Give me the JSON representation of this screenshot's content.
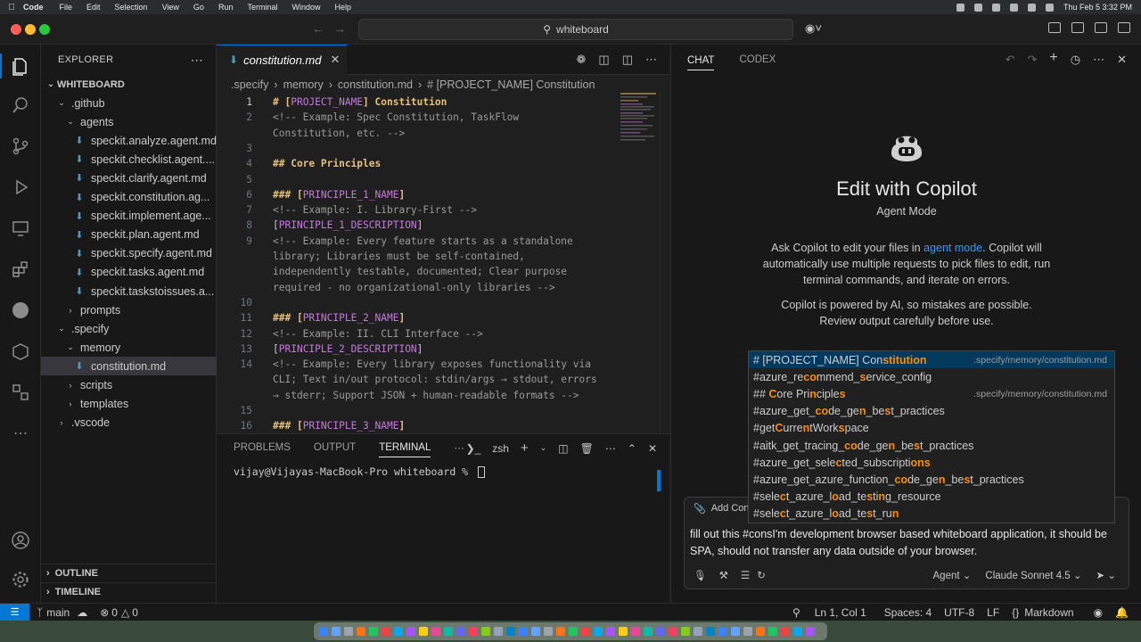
{
  "macbar": {
    "app": "Code",
    "menus": [
      "File",
      "Edit",
      "Selection",
      "View",
      "Go",
      "Run",
      "Terminal",
      "Window",
      "Help"
    ],
    "clock": "Thu Feb 5  3:32 PM"
  },
  "titlebar": {
    "search": "whiteboard"
  },
  "explorer": {
    "title": "EXPLORER",
    "root": "WHITEBOARD",
    "rows": [
      {
        "label": ".github",
        "kind": "folder-open",
        "indent": 1
      },
      {
        "label": "agents",
        "kind": "folder-open",
        "indent": 2
      },
      {
        "label": "speckit.analyze.agent.md",
        "kind": "file",
        "indent": 3
      },
      {
        "label": "speckit.checklist.agent....",
        "kind": "file",
        "indent": 3
      },
      {
        "label": "speckit.clarify.agent.md",
        "kind": "file",
        "indent": 3
      },
      {
        "label": "speckit.constitution.ag...",
        "kind": "file",
        "indent": 3
      },
      {
        "label": "speckit.implement.age...",
        "kind": "file",
        "indent": 3
      },
      {
        "label": "speckit.plan.agent.md",
        "kind": "file",
        "indent": 3
      },
      {
        "label": "speckit.specify.agent.md",
        "kind": "file",
        "indent": 3
      },
      {
        "label": "speckit.tasks.agent.md",
        "kind": "file",
        "indent": 3
      },
      {
        "label": "speckit.taskstoissues.a...",
        "kind": "file",
        "indent": 3
      },
      {
        "label": "prompts",
        "kind": "folder",
        "indent": 2
      },
      {
        "label": ".specify",
        "kind": "folder-open",
        "indent": 1
      },
      {
        "label": "memory",
        "kind": "folder-open",
        "indent": 2
      },
      {
        "label": "constitution.md",
        "kind": "file",
        "indent": 3,
        "selected": true
      },
      {
        "label": "scripts",
        "kind": "folder",
        "indent": 2
      },
      {
        "label": "templates",
        "kind": "folder",
        "indent": 2
      },
      {
        "label": ".vscode",
        "kind": "folder",
        "indent": 1
      }
    ],
    "outline": "OUTLINE",
    "timeline": "TIMELINE"
  },
  "editor": {
    "tab": "constitution.md",
    "breadcrumb": [
      ".specify",
      "memory",
      "constitution.md",
      "# [PROJECT_NAME] Constitution"
    ],
    "lines": [
      {
        "n": "1",
        "html": "<span class='h'># [</span><span class='ph'>PROJECT_NAME</span><span class='h'>] Constitution</span>"
      },
      {
        "n": "2",
        "html": "<span class='c'>&lt;!-- Example: Spec Constitution, TaskFlow</span>"
      },
      {
        "n": "",
        "html": "<span class='c'>Constitution, etc. --&gt;</span>"
      },
      {
        "n": "3",
        "html": ""
      },
      {
        "n": "4",
        "html": "<span class='h'>## Core Principles</span>"
      },
      {
        "n": "5",
        "html": ""
      },
      {
        "n": "6",
        "html": "<span class='h'>### [</span><span class='ph'>PRINCIPLE_1_NAME</span><span class='h'>]</span>"
      },
      {
        "n": "7",
        "html": "<span class='c'>&lt;!-- Example: I. Library-First --&gt;</span>"
      },
      {
        "n": "8",
        "html": "<span>[</span><span class='ph'>PRINCIPLE_1_DESCRIPTION</span><span>]</span>"
      },
      {
        "n": "9",
        "html": "<span class='c'>&lt;!-- Example: Every feature starts as a standalone</span>"
      },
      {
        "n": "",
        "html": "<span class='c'>library; Libraries must be self-contained,</span>"
      },
      {
        "n": "",
        "html": "<span class='c'>independently testable, documented; Clear purpose</span>"
      },
      {
        "n": "",
        "html": "<span class='c'>required - no organizational-only libraries --&gt;</span>"
      },
      {
        "n": "10",
        "html": ""
      },
      {
        "n": "11",
        "html": "<span class='h'>### [</span><span class='ph'>PRINCIPLE_2_NAME</span><span class='h'>]</span>"
      },
      {
        "n": "12",
        "html": "<span class='c'>&lt;!-- Example: II. CLI Interface --&gt;</span>"
      },
      {
        "n": "13",
        "html": "<span>[</span><span class='ph'>PRINCIPLE_2_DESCRIPTION</span><span>]</span>"
      },
      {
        "n": "14",
        "html": "<span class='c'>&lt;!-- Example: Every library exposes functionality via</span>"
      },
      {
        "n": "",
        "html": "<span class='c'>CLI; Text in/out protocol: stdin/args → stdout, errors</span>"
      },
      {
        "n": "",
        "html": "<span class='c'>→ stderr; Support JSON + human-readable formats --&gt;</span>"
      },
      {
        "n": "15",
        "html": ""
      },
      {
        "n": "16",
        "html": "<span class='h'>### [</span><span class='ph'>PRINCIPLE_3_NAME</span><span class='h'>]</span>"
      }
    ]
  },
  "terminal": {
    "tabs": [
      "PROBLEMS",
      "OUTPUT",
      "TERMINAL"
    ],
    "shell": "zsh",
    "prompt": "vijay@Vijayas-MacBook-Pro whiteboard % "
  },
  "chat": {
    "tabs": [
      "CHAT",
      "CODEX"
    ],
    "title": "Edit with Copilot",
    "mode": "Agent Mode",
    "desc_pre": "Ask Copilot to edit your files in ",
    "desc_link": "agent mode",
    "desc_post": ". Copilot will automatically use multiple requests to pick files to edit, run terminal commands, and iterate on errors.",
    "disclaimer": "Copilot is powered by AI, so mistakes are possible. Review output carefully before use.",
    "suggestions": [
      {
        "html": "# [PROJECT_NAME] Con<b style='color:#ff8c00'>stitution</b>",
        "hint": ".specify/memory/constitution.md",
        "selected": true
      },
      {
        "html": "#azure_re<b style='color:#ff8c00'>co</b>mmend_<b style='color:#ff8c00'>s</b>ervice_config",
        "hint": ""
      },
      {
        "html": "## <b style='color:#ff8c00'>C</b>ore Pri<b style='color:#ff8c00'>n</b>ciple<b style='color:#ff8c00'>s</b>",
        "hint": ".specify/memory/constitution.md"
      },
      {
        "html": "#azure_get_<b style='color:#ff8c00'>co</b>de_ge<b style='color:#ff8c00'>n</b>_be<b style='color:#ff8c00'>s</b>t_practices",
        "hint": ""
      },
      {
        "html": "#get<b style='color:#ff8c00'>C</b>urre<b style='color:#ff8c00'>n</b>tWork<b style='color:#ff8c00'>s</b>pace",
        "hint": ""
      },
      {
        "html": "#aitk_get_tracing_<b style='color:#ff8c00'>co</b>de_ge<b style='color:#ff8c00'>n</b>_be<b style='color:#ff8c00'>s</b>t_practices",
        "hint": ""
      },
      {
        "html": "#azure_get_sele<b style='color:#ff8c00'>c</b>ted_subscripti<b style='color:#ff8c00'>ons</b>",
        "hint": ""
      },
      {
        "html": "#azure_get_azure_function_<b style='color:#ff8c00'>co</b>de_ge<b style='color:#ff8c00'>n</b>_be<b style='color:#ff8c00'>s</b>t_practices",
        "hint": ""
      },
      {
        "html": "#sele<b style='color:#ff8c00'>c</b>t_azure_l<b style='color:#ff8c00'>o</b>ad_te<b style='color:#ff8c00'>s</b>ti<b style='color:#ff8c00'>n</b>g_resource",
        "hint": ""
      },
      {
        "html": "#sele<b style='color:#ff8c00'>c</b>t_azure_l<b style='color:#ff8c00'>o</b>ad_te<b style='color:#ff8c00'>s</b>t_ru<b style='color:#ff8c00'>n</b>",
        "hint": ""
      }
    ],
    "add_context": "Add Con",
    "input_text": "fill out this #consI'm development browser based whiteboard application, it should be SPA, should not transfer any data outside of your browser.",
    "agent": "Agent",
    "model": "Claude Sonnet 4.5"
  },
  "status": {
    "branch": "main",
    "errors": "0",
    "warnings": "0",
    "position": "Ln 1, Col 1",
    "spaces": "Spaces: 4",
    "encoding": "UTF-8",
    "eol": "LF",
    "language": "Markdown"
  },
  "colors": {
    "accent": "#0078d4",
    "heading": "#e5c07b",
    "placeholder": "#c678dd",
    "link": "#3794ff",
    "match": "#ff8c00"
  }
}
